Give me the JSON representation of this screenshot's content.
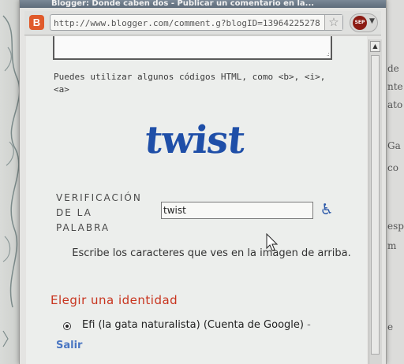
{
  "window": {
    "title": "Blogger: Donde caben dos - Publicar un comentario en la..."
  },
  "address_bar": {
    "favicon_letter": "B",
    "url": "http://www.blogger.com/comment.g?blogID=13964225278",
    "sep_badge": "SEP"
  },
  "comment_form": {
    "html_note_line1": "Puedes utilizar algunos códigos HTML, como <b>, <i>,",
    "html_note_line2": "<a>"
  },
  "captcha": {
    "image_text": "twist"
  },
  "verification": {
    "label_line1": "VERIFICACIÓN",
    "label_line2": "DE LA",
    "label_line3": "PALABRA",
    "input_value": "twist",
    "hint": "Escribe los caracteres que ves en la imagen de arriba."
  },
  "identity": {
    "title": "Elegir una identidad",
    "selected_option": "Efi (la gata naturalista) (Cuenta de Google)",
    "separator": "-",
    "signout_link": "Salir"
  },
  "background_page": {
    "fragments": [
      "de",
      "nte",
      "ato",
      "Ga",
      "co",
      "esp",
      "m",
      "e"
    ]
  },
  "colors": {
    "identity_title": "#c8341e",
    "link": "#4a76c2",
    "captcha": "#1f4fa8"
  }
}
